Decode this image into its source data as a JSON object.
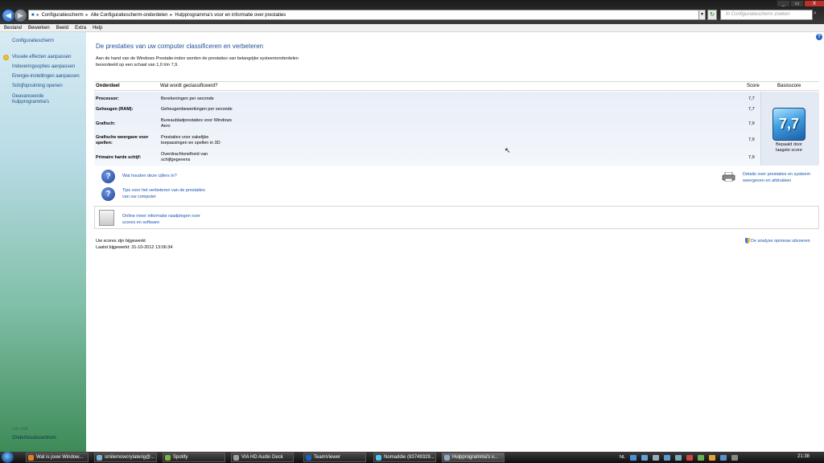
{
  "window": {
    "breadcrumbs": [
      "Configuratiescherm",
      "Alle Configuratiescherm-onderdelen",
      "Hulpprogramma's voor en informatie over prestaties"
    ],
    "search_placeholder": "In Configuratiescherm zoeken",
    "controls": [
      "_",
      "▭",
      "X"
    ]
  },
  "menu": [
    "Bestand",
    "Bewerken",
    "Beeld",
    "Extra",
    "Help"
  ],
  "sidebar": {
    "home": "Configuratiescherm",
    "links": [
      "Visuele effecten aanpassen",
      "Indexeringsopties aanpassen",
      "Energie-instellingen aanpassen",
      "Schijfopruiming openen",
      "Geavanceerde",
      "hulpprogramma's"
    ],
    "see_also_label": "Zie ook",
    "see_also": "Onderhoudscentrum"
  },
  "main": {
    "title": "De prestaties van uw computer classificeren en verbeteren",
    "description_line1": "Aan de hand van de Windows Prestatie-index worden de prestaties van belangrijke systeemonderdelen",
    "description_line2": "beoordeeld op een schaal van 1,0 t/m 7,9.",
    "table": {
      "headers": {
        "component": "Onderdeel",
        "rated": "Wat wordt geclassificeerd?",
        "score": "Score",
        "base": "Basisscore"
      },
      "rows": [
        {
          "component": "Processor:",
          "desc1": "Berekeningen per seconde",
          "desc2": "",
          "score": "7,7"
        },
        {
          "component": "Geheugen (RAM):",
          "desc1": "Geheugenbewerkingen per seconde",
          "desc2": "",
          "score": "7,7"
        },
        {
          "component": "Grafisch:",
          "desc1": "Bureaubladprestaties voor Windows",
          "desc2": "Aero",
          "score": "7,9"
        },
        {
          "component": "Grafische weergave voor",
          "component2": "spellen:",
          "desc1": "Prestaties voor zakelijke",
          "desc2": "toepassingen en spellen in 3D",
          "score": "7,9"
        },
        {
          "component": "Primaire harde schijf:",
          "desc1": "Overdrachtsnelheid van",
          "desc2": "schijfgegevens",
          "score": "7,9"
        }
      ],
      "base_score": "7,7",
      "base_caption1": "Bepaald door",
      "base_caption2": "laagste score"
    },
    "links": {
      "numbers": "Wat houden deze cijfers in?",
      "tips1": "Tips voor het verbeteren van de prestaties",
      "tips2": "van uw computer",
      "details1": "Details over prestaties en systeem",
      "details2": "weergeven en afdrukken",
      "online1": "Online meer informatie raadplegen over",
      "online2": "scores en software",
      "rerun": "De analyse opnieuw uitvoeren"
    },
    "status1": "Uw scores zijn bijgewerkt",
    "status2": "Laatst bijgewerkt: 31-10-2012 13:06:34"
  },
  "taskbar": {
    "items": [
      {
        "label": "Wat is jouw Window...",
        "color": "#e67e22"
      },
      {
        "label": "smilemowcrylaterig@...",
        "color": "#7fb3d5"
      },
      {
        "label": "Spotify",
        "color": "#7cb342"
      },
      {
        "label": "VIA HD Audio Deck",
        "color": "#a0a0a0"
      },
      {
        "label": "TeamViewer",
        "color": "#1565c0"
      },
      {
        "label": "Nomaddie (83749329...",
        "color": "#4fc3f7"
      },
      {
        "label": "Hulpprogramma's v...",
        "color": "#8da9c4"
      }
    ],
    "lang": "NL",
    "clock": "21:38"
  }
}
